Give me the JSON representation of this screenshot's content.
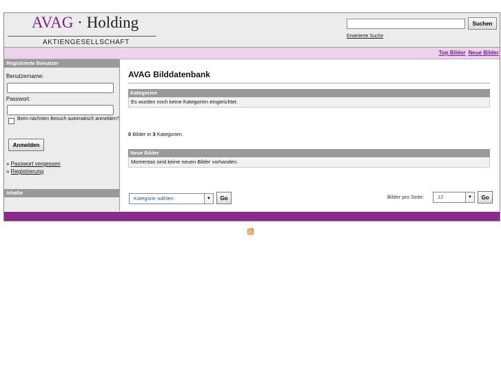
{
  "header": {
    "logo_brand": "AVAG",
    "logo_separator": " · ",
    "logo_holding": "Holding",
    "logo_subtitle": "AKTIENGESELLSCHAFT",
    "search_value": "",
    "search_button": "Suchen",
    "advanced_search": "Erweiterte Suche"
  },
  "topnav": {
    "top_images": "Top Bilder",
    "new_images": "Neue Bilder"
  },
  "sidebar": {
    "login_header": "Registrierte Benutzer",
    "username_label": "Benutzername:",
    "password_label": "Passwort:",
    "remember_label": "Beim nächsten Besuch automatisch anmelden?",
    "login_button": "Anmelden",
    "forgot_password": "Passwort vergessen",
    "register": "Registrierung",
    "link_bullet": "» ",
    "content_header": "Inhalte"
  },
  "main": {
    "title": "AVAG Bilddatenbank",
    "categories_header": "Kategorien",
    "categories_body": "Es wurden noch keine Kategorien eingerichtet.",
    "stats_images": "0",
    "stats_mid": " Bilder in ",
    "stats_categories": "3",
    "stats_end": " Kategorien.",
    "new_images_header": "Neue Bilder",
    "new_images_body": "Momentan sind keine neuen Bilder vorhanden.",
    "category_select": "Kategorie wählen",
    "go_label": "Go",
    "per_page_label": "Bilder pro Seite:",
    "per_page_value": "12"
  },
  "colors": {
    "accent": "#8b2a8f",
    "topbar": "#ebd3eb",
    "header_bg": "#ececec"
  },
  "icons": {
    "rss": "rss-icon"
  }
}
